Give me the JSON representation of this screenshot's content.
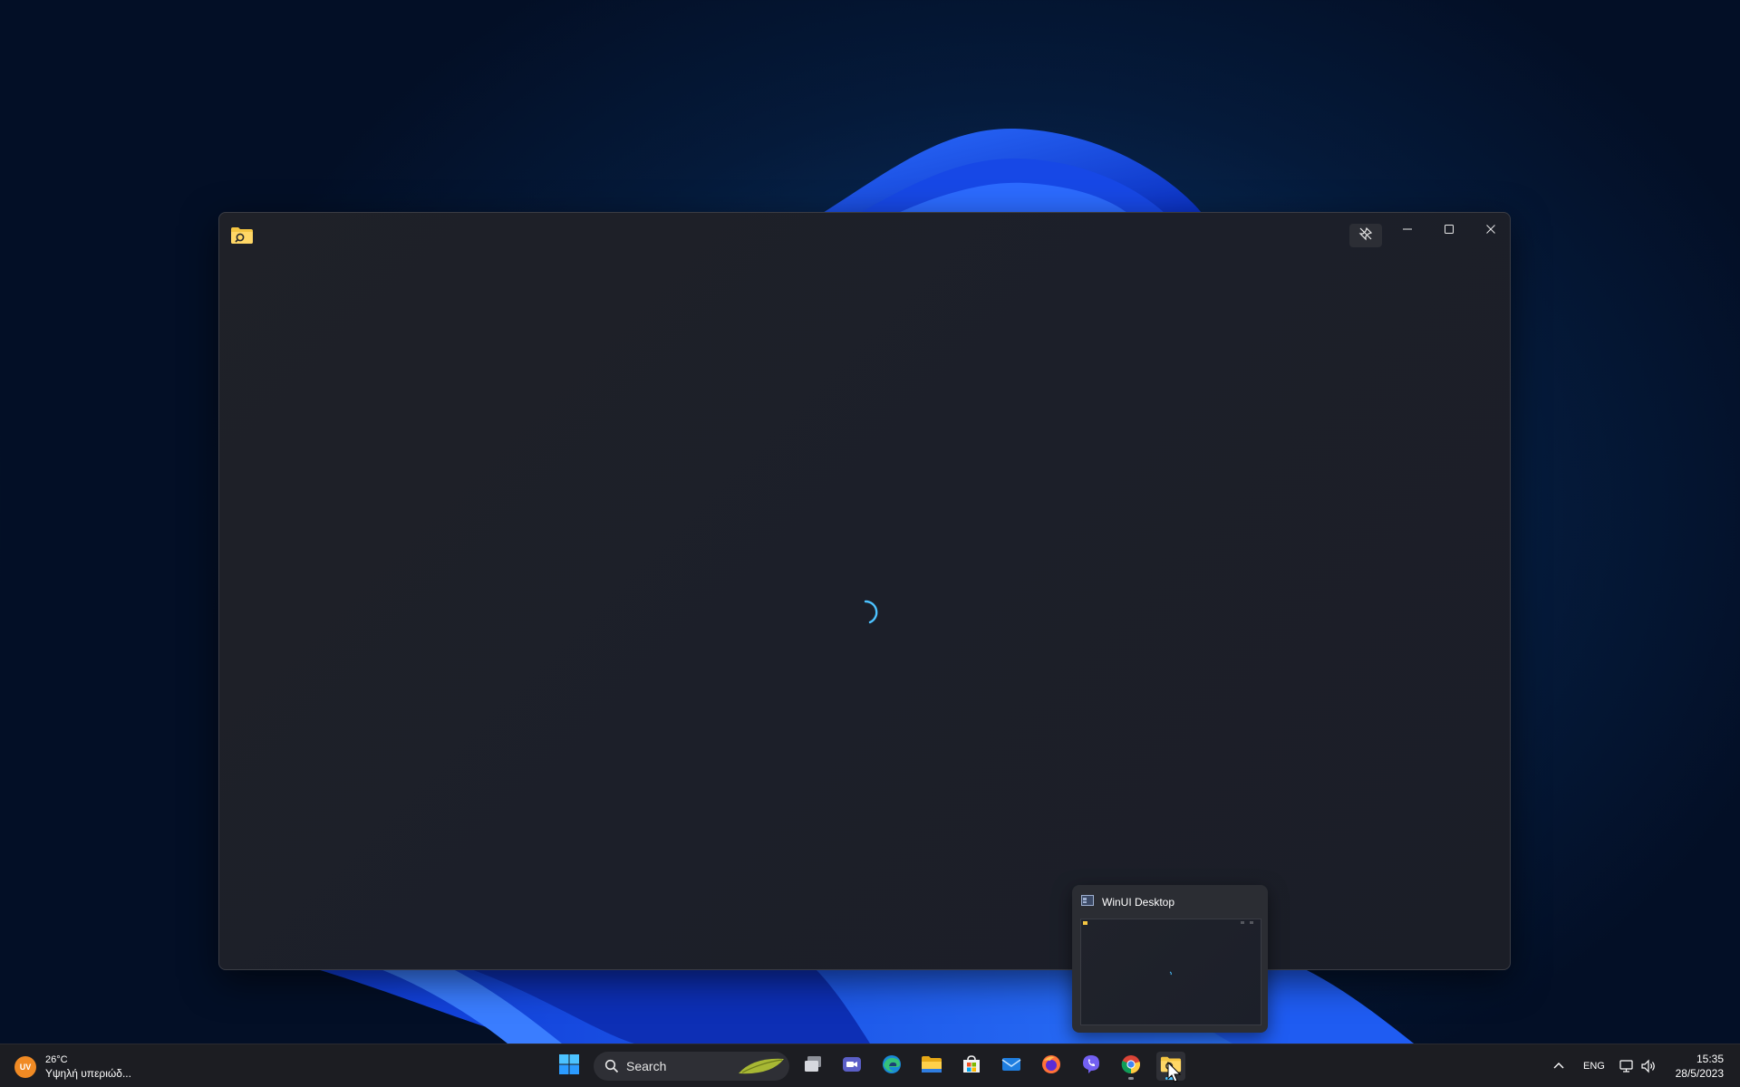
{
  "desktop": {
    "wallpaper": "windows-11-bloom",
    "accent_color": "#1e56e8"
  },
  "window": {
    "app_icon": "folder-search-icon",
    "pin_icon": "unpin-icon",
    "minimize_icon": "minimize-icon",
    "maximize_icon": "maximize-icon",
    "close_icon": "close-icon",
    "status": "loading",
    "spinner_color": "#4cc2ff"
  },
  "taskbar_preview": {
    "title": "WinUI Desktop",
    "icon": "app-window-icon"
  },
  "taskbar": {
    "weather": {
      "badge": "UV",
      "temperature": "26°C",
      "description": "Υψηλή υπεριώδ..."
    },
    "start_icon": "windows-start-icon",
    "search": {
      "label": "Search",
      "icon": "search-icon"
    },
    "pinned_apps": [
      {
        "name": "task-view",
        "icon": "task-view-icon"
      },
      {
        "name": "teams",
        "icon": "teams-icon"
      },
      {
        "name": "edge",
        "icon": "edge-icon"
      },
      {
        "name": "file-explorer",
        "icon": "file-explorer-icon"
      },
      {
        "name": "microsoft-store",
        "icon": "store-icon"
      },
      {
        "name": "mail",
        "icon": "mail-icon"
      },
      {
        "name": "firefox",
        "icon": "firefox-icon"
      },
      {
        "name": "viber",
        "icon": "viber-icon"
      },
      {
        "name": "chrome",
        "icon": "chrome-icon"
      },
      {
        "name": "winui-desktop",
        "icon": "folder-search-icon"
      }
    ],
    "tray": {
      "chevron_icon": "chevron-up-icon",
      "language": "ENG",
      "network_icon": "network-icon",
      "volume_icon": "volume-icon",
      "time": "15:35",
      "date": "28/5/2023"
    }
  }
}
